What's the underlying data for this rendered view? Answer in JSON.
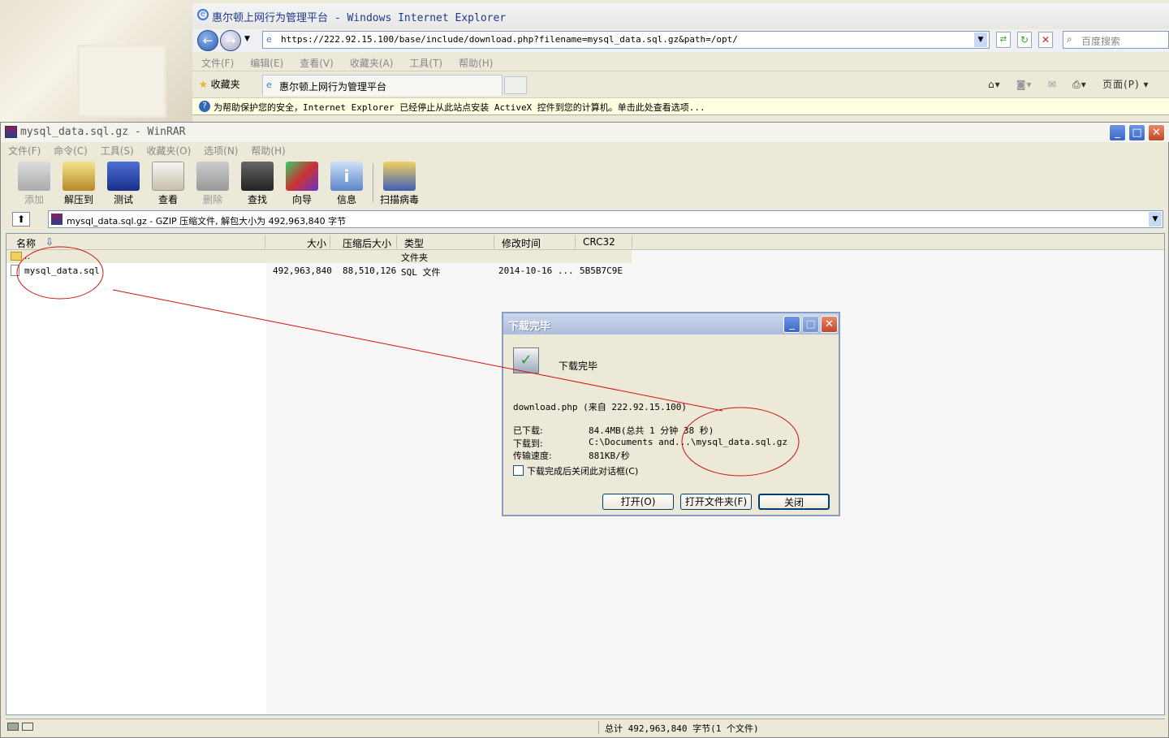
{
  "ie": {
    "title": "惠尔顿上网行为管理平台 - Windows Internet Explorer",
    "url": "https://222.92.15.100/base/include/download.php?filename=mysql_data.sql.gz&path=/opt/",
    "search_placeholder": "百度搜索",
    "menu": [
      "文件(F)",
      "编辑(E)",
      "查看(V)",
      "收藏夹(A)",
      "工具(T)",
      "帮助(H)"
    ],
    "favorites_label": "收藏夹",
    "tab_label": "惠尔顿上网行为管理平台",
    "page_label": "页面(P) ▾",
    "infobar": "为帮助保护您的安全，Internet Explorer 已经停止从此站点安装 ActiveX 控件到您的计算机。单击此处查看选项..."
  },
  "winrar": {
    "title": "mysql_data.sql.gz - WinRAR",
    "menu": [
      "文件(F)",
      "命令(C)",
      "工具(S)",
      "收藏夹(O)",
      "选项(N)",
      "帮助(H)"
    ],
    "toolbar": [
      {
        "label": "添加",
        "enabled": false,
        "icon": "add-icon"
      },
      {
        "label": "解压到",
        "enabled": true,
        "icon": "extract-icon"
      },
      {
        "label": "测试",
        "enabled": true,
        "icon": "test-icon"
      },
      {
        "label": "查看",
        "enabled": true,
        "icon": "view-icon"
      },
      {
        "label": "删除",
        "enabled": false,
        "icon": "delete-icon"
      },
      {
        "label": "查找",
        "enabled": true,
        "icon": "find-icon"
      },
      {
        "label": "向导",
        "enabled": true,
        "icon": "wizard-icon"
      },
      {
        "label": "信息",
        "enabled": true,
        "icon": "info-icon"
      },
      {
        "label": "扫描病毒",
        "enabled": true,
        "icon": "scan-virus-icon"
      }
    ],
    "path": "mysql_data.sql.gz - GZIP 压缩文件, 解包大小为 492,963,840 字节",
    "columns": {
      "name": "名称",
      "size": "大小",
      "packed": "压缩后大小",
      "type": "类型",
      "modified": "修改时间",
      "crc": "CRC32"
    },
    "rows": [
      {
        "name": "..",
        "size": "",
        "packed": "",
        "type": "文件夹",
        "modified": "",
        "crc": ""
      },
      {
        "name": "mysql_data.sql",
        "size": "492,963,840",
        "packed": "88,510,126",
        "type": "SQL 文件",
        "modified": "2014-10-16 ...",
        "crc": "5B5B7C9E"
      }
    ],
    "status": "总计 492,963,840 字节(1 个文件)"
  },
  "dialog": {
    "title": "下载完毕",
    "heading": "下载完毕",
    "source": "download.php (来自 222.92.15.100)",
    "downloaded_label": "已下载:",
    "downloaded_value": "84.4MB(总共 1 分钟 38 秒)",
    "saveto_label": "下载到:",
    "saveto_value": "C:\\Documents and...\\mysql_data.sql.gz",
    "speed_label": "传输速度:",
    "speed_value": "881KB/秒",
    "checkbox_label": "下载完成后关闭此对话框(C)",
    "checkbox_checked": false,
    "open_button": "打开(O)",
    "open_folder_button": "打开文件夹(F)",
    "close_button": "关闭"
  }
}
